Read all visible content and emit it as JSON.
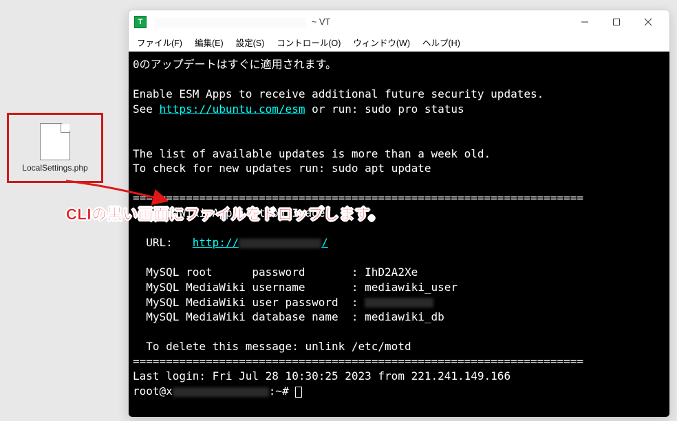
{
  "desktop": {
    "file_name": "LocalSettings.php"
  },
  "window": {
    "title_suffix": "~ VT",
    "menus": {
      "file": "ファイル(F)",
      "edit": "編集(E)",
      "setup": "設定(S)",
      "control": "コントロール(O)",
      "window": "ウィンドウ(W)",
      "help": "ヘルプ(H)"
    }
  },
  "terminal": {
    "line1": "0のアップデートはすぐに適用されます。",
    "line2": "Enable ESM Apps to receive additional future security updates.",
    "line3_a": "See ",
    "line3_link": "https://ubuntu.com/esm",
    "line3_b": " or run: sudo pro status",
    "line4": "The list of available updates is more than a week old.",
    "line5": "To check for new updates run: sudo apt update",
    "divider_top": "====================================================================",
    "app_title": "  MediaWiki Application Image",
    "url_label": "  URL:   ",
    "url_prefix": "http://",
    "url_suffix": "/",
    "mysql_root": "  MySQL root      password       : IhD2A2Xe",
    "mysql_user": "  MySQL MediaWiki username       : mediawiki_user",
    "mysql_pass_l": "  MySQL MediaWiki user password  : ",
    "mysql_db": "  MySQL MediaWiki database name  : mediawiki_db",
    "delete_msg": "  To delete this message: unlink /etc/motd",
    "divider_bot": "====================================================================",
    "last_login": "Last login: Fri Jul 28 10:30:25 2023 from 221.241.149.166",
    "prompt_a": "root@x",
    "prompt_b": ":~# "
  },
  "annotation": {
    "text": "CLIの黒い画面にファイルをドロップします。"
  },
  "colors": {
    "highlight_red": "#d01818",
    "terminal_link": "#00ffff"
  }
}
